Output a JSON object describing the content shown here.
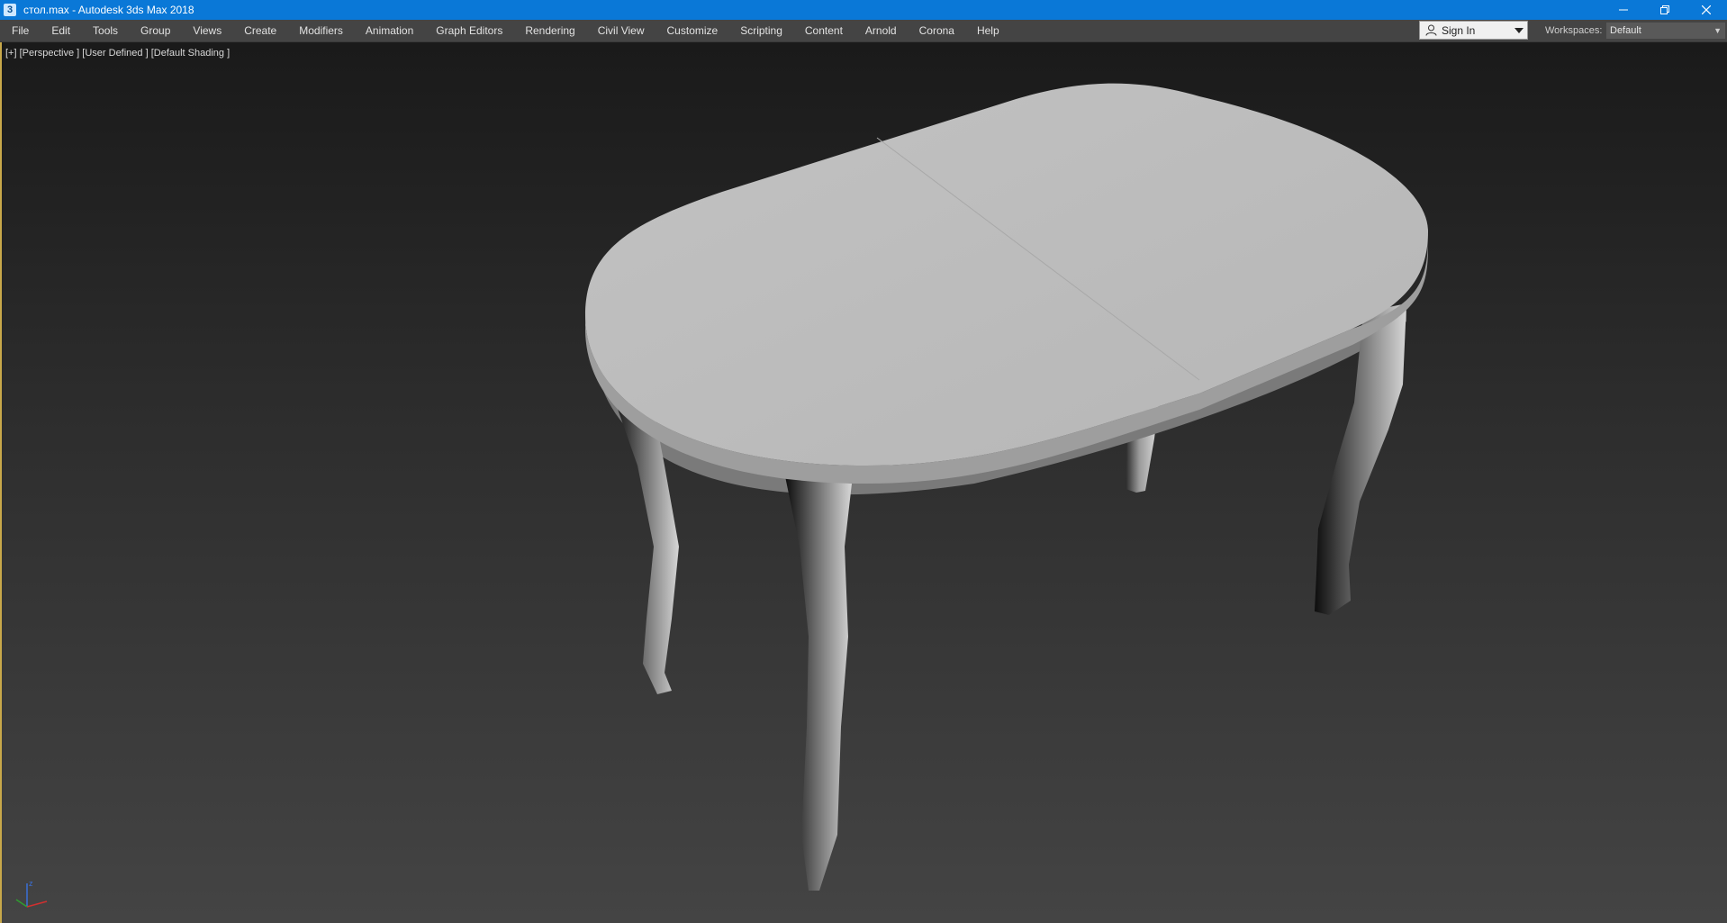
{
  "titlebar": {
    "title": "стол.max - Autodesk 3ds Max 2018",
    "icon_label": "3"
  },
  "menu": {
    "items": [
      {
        "label": "File"
      },
      {
        "label": "Edit"
      },
      {
        "label": "Tools"
      },
      {
        "label": "Group"
      },
      {
        "label": "Views"
      },
      {
        "label": "Create"
      },
      {
        "label": "Modifiers"
      },
      {
        "label": "Animation"
      },
      {
        "label": "Graph Editors"
      },
      {
        "label": "Rendering"
      },
      {
        "label": "Civil View"
      },
      {
        "label": "Customize"
      },
      {
        "label": "Scripting"
      },
      {
        "label": "Content"
      },
      {
        "label": "Arnold"
      },
      {
        "label": "Corona"
      },
      {
        "label": "Help"
      }
    ],
    "signin_label": "Sign In",
    "workspaces_label": "Workspaces:",
    "workspace_value": "Default"
  },
  "viewport": {
    "label": "[+] [Perspective ] [User Defined ] [Default Shading ]",
    "axis_z": "z"
  },
  "colors": {
    "titlebar": "#0a78d7",
    "menubar": "#444444",
    "viewport_border": "#c8a84a",
    "table_top": "#bdbdbd"
  },
  "icons": {
    "app": "3ds-max-icon",
    "user": "user-icon",
    "minimize": "minimize-icon",
    "restore": "restore-icon",
    "close": "close-icon"
  }
}
